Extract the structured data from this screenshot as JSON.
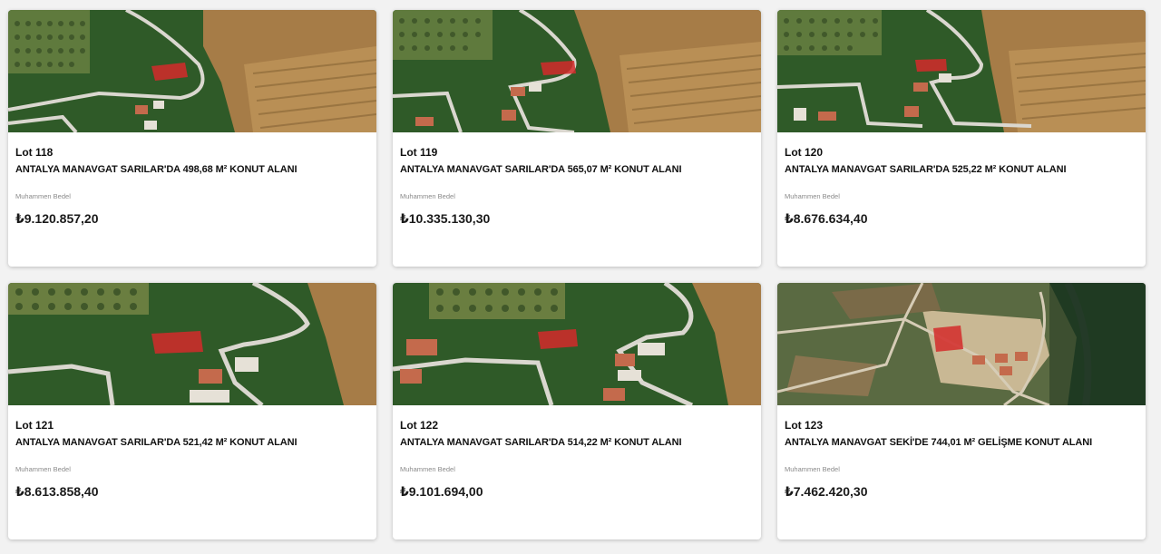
{
  "price_label": "Muhammen Bedel",
  "colors": {
    "parcel": "#d42a2a",
    "field": "#2e5a25",
    "dirt": "#a87c45",
    "road": "#d9d6cf"
  },
  "lots": [
    {
      "lot": "Lot 118",
      "title": "ANTALYA MANAVGAT SARILAR'DA 498,68 M² KONUT ALANI",
      "price_label": "Muhammen Bedel",
      "price": "₺9.120.857,20"
    },
    {
      "lot": "Lot 119",
      "title": "ANTALYA MANAVGAT SARILAR'DA 565,07 M² KONUT ALANI",
      "price_label": "Muhammen Bedel",
      "price": "₺10.335.130,30"
    },
    {
      "lot": "Lot 120",
      "title": "ANTALYA MANAVGAT SARILAR'DA 525,22 M² KONUT ALANI",
      "price_label": "Muhammen Bedel",
      "price": "₺8.676.634,40"
    },
    {
      "lot": "Lot 121",
      "title": "ANTALYA MANAVGAT SARILAR'DA 521,42 M² KONUT ALANI",
      "price_label": "Muhammen Bedel",
      "price": "₺8.613.858,40"
    },
    {
      "lot": "Lot 122",
      "title": "ANTALYA MANAVGAT SARILAR'DA 514,22 M² KONUT ALANI",
      "price_label": "Muhammen Bedel",
      "price": "₺9.101.694,00"
    },
    {
      "lot": "Lot 123",
      "title": "ANTALYA MANAVGAT SEKİ'DE 744,01 M² GELİŞME KONUT ALANI",
      "price_label": "Muhammen Bedel",
      "price": "₺7.462.420,30"
    }
  ]
}
